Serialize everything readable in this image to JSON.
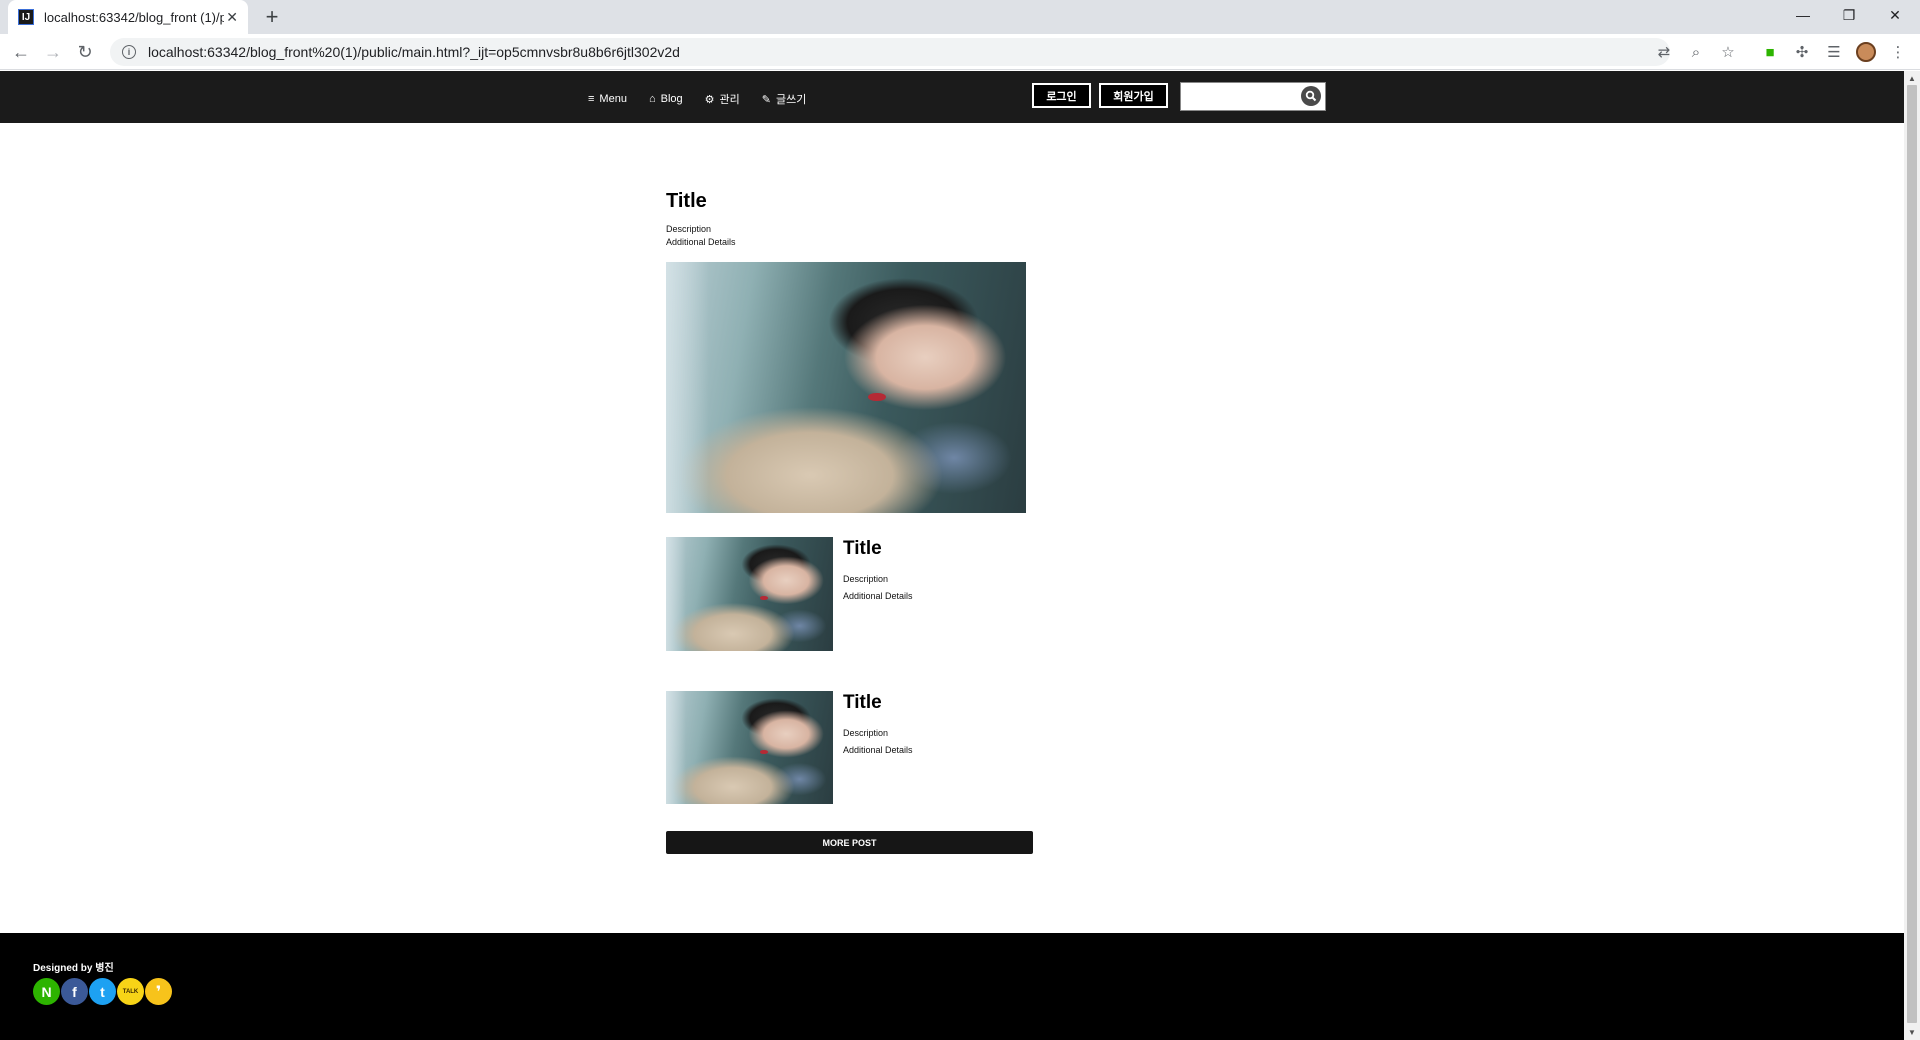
{
  "browser": {
    "tab_title": "localhost:63342/blog_front (1)/p",
    "favicon_text": "IJ",
    "url": "localhost:63342/blog_front%20(1)/public/main.html?_ijt=op5cmnvsbr8u8b6r6jtl302v2d"
  },
  "header": {
    "nav": [
      {
        "icon": "menu-icon",
        "glyph": "≡",
        "label": "Menu"
      },
      {
        "icon": "home-icon",
        "glyph": "⌂",
        "label": "Blog"
      },
      {
        "icon": "gears-icon",
        "glyph": "⚙",
        "label": "관리"
      },
      {
        "icon": "edit-icon",
        "glyph": "✎",
        "label": "글쓰기"
      }
    ],
    "login_label": "로그인",
    "signup_label": "회원가입",
    "search_placeholder": ""
  },
  "featured": {
    "title": "Title",
    "description": "Description",
    "details": "Additional Details"
  },
  "posts": [
    {
      "title": "Title",
      "description": "Description",
      "details": "Additional Details"
    },
    {
      "title": "Title",
      "description": "Description",
      "details": "Additional Details"
    }
  ],
  "more_label": "MORE POST",
  "footer": {
    "designed_prefix": "Designed by ",
    "author": "병진",
    "social": [
      {
        "name": "naver-icon",
        "glyph": "N",
        "color": "#2db400"
      },
      {
        "name": "facebook-icon",
        "glyph": "f",
        "color": "#3b5998"
      },
      {
        "name": "twitter-icon",
        "glyph": "t",
        "color": "#1da1f2"
      },
      {
        "name": "kakaotalk-icon",
        "glyph": "TALK",
        "color": "#f7d417"
      },
      {
        "name": "kakaostory-icon",
        "glyph": "❜",
        "color": "#f7c31b"
      }
    ]
  }
}
